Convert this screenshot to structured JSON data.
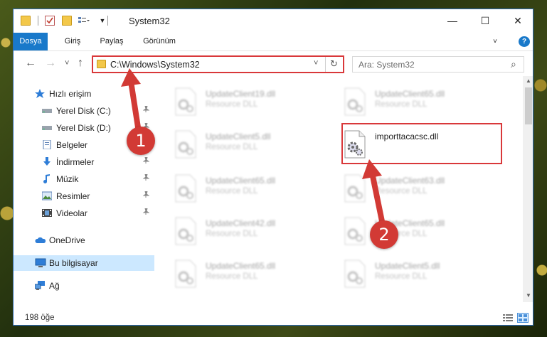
{
  "window": {
    "title": "System32",
    "controls": {
      "minimize": "—",
      "maximize": "☐",
      "close": "✕"
    }
  },
  "ribbon": {
    "tabs": [
      {
        "label": "Dosya",
        "active": true
      },
      {
        "label": "Giriş"
      },
      {
        "label": "Paylaş"
      },
      {
        "label": "Görünüm"
      }
    ],
    "help_glyph": "?"
  },
  "nav": {
    "back": "←",
    "forward": "→",
    "recent": "˅",
    "up": "↑",
    "address": "C:\\Windows\\System32",
    "address_dropdown": "˅",
    "refresh": "↻",
    "search_placeholder": "Ara: System32",
    "search_glyph": "⌕"
  },
  "sidebar": {
    "items": [
      {
        "label": "Hızlı erişim",
        "icon": "star-icon",
        "pinned": false
      },
      {
        "label": "Yerel Disk (C:)",
        "icon": "drive-icon",
        "pinned": true
      },
      {
        "label": "Yerel Disk (D:)",
        "icon": "drive-icon",
        "pinned": true
      },
      {
        "label": "Belgeler",
        "icon": "documents-icon",
        "pinned": true
      },
      {
        "label": "İndirmeler",
        "icon": "download-icon",
        "pinned": true
      },
      {
        "label": "Müzik",
        "icon": "music-icon",
        "pinned": true
      },
      {
        "label": "Resimler",
        "icon": "pictures-icon",
        "pinned": true
      },
      {
        "label": "Videolar",
        "icon": "videos-icon",
        "pinned": true
      },
      {
        "label": "OneDrive",
        "icon": "onedrive-icon",
        "pinned": false
      },
      {
        "label": "Bu bilgisayar",
        "icon": "computer-icon",
        "pinned": false,
        "selected": true
      },
      {
        "label": "Ağ",
        "icon": "network-icon",
        "pinned": false
      }
    ],
    "pin_glyph": "📌"
  },
  "files": [
    {
      "name": "UpdateClient19.dll",
      "type": "Resource DLL"
    },
    {
      "name": "UpdateClient65.dll",
      "type": "Resource DLL"
    },
    {
      "name": "UpdateClient5.dll",
      "type": "Resource DLL"
    },
    {
      "name": "importtacacsc.dll",
      "type": "",
      "highlighted": true
    },
    {
      "name": "UpdateClient65.dll",
      "type": "Resource DLL"
    },
    {
      "name": "UpdateClient63.dll",
      "type": "Resource DLL"
    },
    {
      "name": "UpdateClient42.dll",
      "type": "Resource DLL"
    },
    {
      "name": "UpdateClient65.dll",
      "type": "Resource DLL"
    },
    {
      "name": "UpdateClient65.dll",
      "type": "Resource DLL"
    },
    {
      "name": "UpdateClient5.dll",
      "type": "Resource DLL"
    }
  ],
  "status": {
    "count": "198 öğe"
  },
  "callouts": [
    "1",
    "2"
  ],
  "colors": {
    "accent": "#1979ca",
    "highlight": "#d9383a",
    "selected": "#cce8ff"
  }
}
